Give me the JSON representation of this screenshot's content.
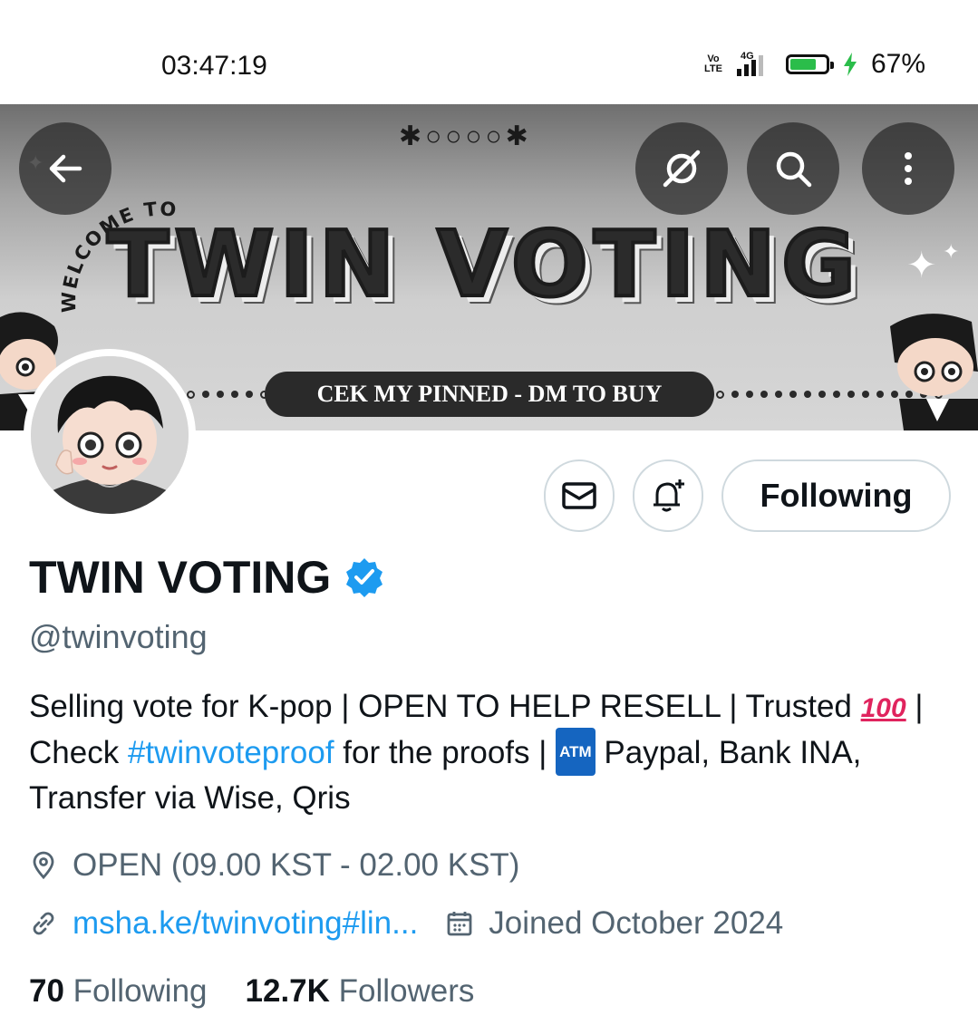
{
  "status_bar": {
    "time": "03:47:19",
    "volte": "Vo LTE",
    "network": "4G",
    "battery_percent": "67%",
    "battery_level": 0.67
  },
  "banner": {
    "welcome": "WELCOME TO",
    "title": "TWIN VOTING",
    "pill_text": "CEK MY PINNED - DM TO BUY"
  },
  "toolbar": {
    "back_icon": "arrow-left-icon",
    "grok_icon": "grok-icon",
    "search_icon": "search-icon",
    "more_icon": "more-vertical-icon"
  },
  "actions": {
    "message_icon": "mail-icon",
    "notify_icon": "bell-plus-icon",
    "following_label": "Following"
  },
  "profile": {
    "name": "TWIN VOTING",
    "handle": "@twinvoting",
    "bio_part1": "Selling vote for K-pop | OPEN TO HELP RESELL | Trusted ",
    "bio_emoji_100": "100",
    "bio_part2": " | Check ",
    "bio_hashtag": "#twinvoteproof",
    "bio_part3": " for the proofs | ",
    "bio_emoji_atm": "ATM",
    "bio_part4": " Paypal,  Bank INA, Transfer via Wise, Qris",
    "location": "OPEN (09.00 KST - 02.00 KST)",
    "link": "msha.ke/twinvoting#lin...",
    "joined": "Joined October 2024",
    "following_count": "70",
    "following_label": "Following",
    "followers_count": "12.7K",
    "followers_label": "Followers"
  },
  "colors": {
    "accent": "#1d9bf0",
    "secondary_text": "#536471",
    "primary_text": "#0f1419",
    "border": "#cfd9de"
  }
}
